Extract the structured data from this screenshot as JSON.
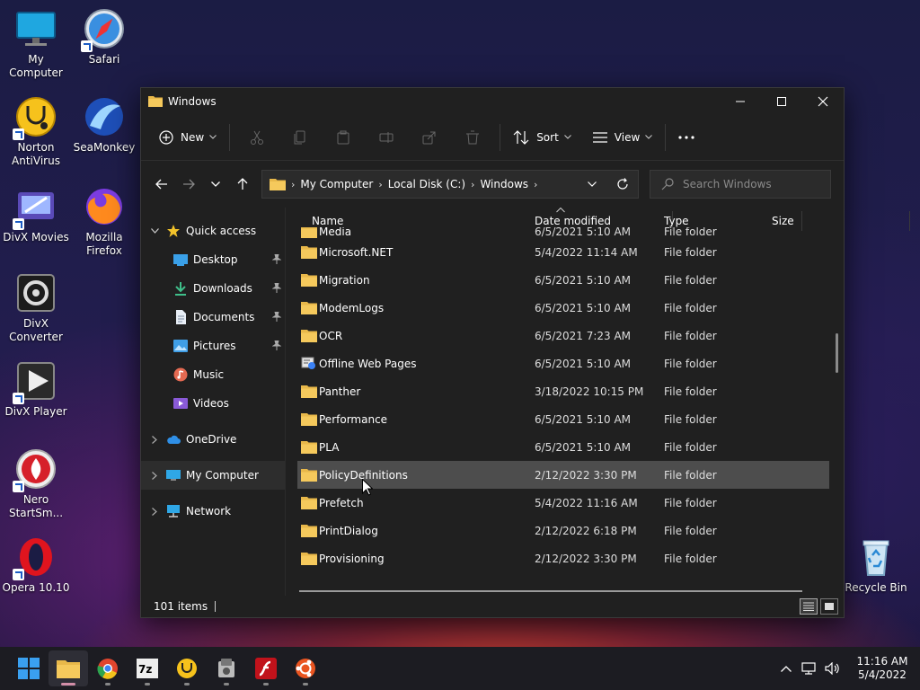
{
  "desktop": {
    "icons": [
      {
        "label": "My Computer"
      },
      {
        "label": "Safari"
      },
      {
        "label": "Norton AntiVirus"
      },
      {
        "label": "SeaMonkey"
      },
      {
        "label": "DivX Movies"
      },
      {
        "label": "Mozilla Firefox"
      },
      {
        "label": "DivX Converter"
      },
      {
        "label": "DivX Player"
      },
      {
        "label": "Nero StartSm..."
      },
      {
        "label": "Opera 10.10"
      },
      {
        "label": "Recycle Bin"
      }
    ]
  },
  "window": {
    "title": "Windows",
    "toolbar": {
      "new_label": "New",
      "sort_label": "Sort",
      "view_label": "View"
    },
    "address": {
      "crumbs": [
        "My Computer",
        "Local Disk (C:)",
        "Windows"
      ]
    },
    "search": {
      "placeholder": "Search Windows"
    },
    "nav": {
      "quick_access": "Quick access",
      "items": [
        "Desktop",
        "Downloads",
        "Documents",
        "Pictures",
        "Music",
        "Videos"
      ],
      "onedrive": "OneDrive",
      "my_computer": "My Computer",
      "network": "Network"
    },
    "columns": {
      "name": "Name",
      "date": "Date modified",
      "type": "Type",
      "size": "Size"
    },
    "rows": [
      {
        "name": "Media",
        "date": "6/5/2021 5:10 AM",
        "type": "File folder"
      },
      {
        "name": "Microsoft.NET",
        "date": "5/4/2022 11:14 AM",
        "type": "File folder"
      },
      {
        "name": "Migration",
        "date": "6/5/2021 5:10 AM",
        "type": "File folder"
      },
      {
        "name": "ModemLogs",
        "date": "6/5/2021 5:10 AM",
        "type": "File folder"
      },
      {
        "name": "OCR",
        "date": "6/5/2021 7:23 AM",
        "type": "File folder"
      },
      {
        "name": "Offline Web Pages",
        "date": "6/5/2021 5:10 AM",
        "type": "File folder"
      },
      {
        "name": "Panther",
        "date": "3/18/2022 10:15 PM",
        "type": "File folder"
      },
      {
        "name": "Performance",
        "date": "6/5/2021 5:10 AM",
        "type": "File folder"
      },
      {
        "name": "PLA",
        "date": "6/5/2021 5:10 AM",
        "type": "File folder"
      },
      {
        "name": "PolicyDefinitions",
        "date": "2/12/2022 3:30 PM",
        "type": "File folder"
      },
      {
        "name": "Prefetch",
        "date": "5/4/2022 11:16 AM",
        "type": "File folder"
      },
      {
        "name": "PrintDialog",
        "date": "2/12/2022 6:18 PM",
        "type": "File folder"
      },
      {
        "name": "Provisioning",
        "date": "2/12/2022 3:30 PM",
        "type": "File folder"
      }
    ],
    "status": {
      "items": "101 items"
    }
  },
  "taskbar": {
    "clock_time": "11:16 AM",
    "clock_date": "5/4/2022"
  },
  "colors": {
    "folder": "#e8b84a",
    "accent": "#3b82f6"
  }
}
